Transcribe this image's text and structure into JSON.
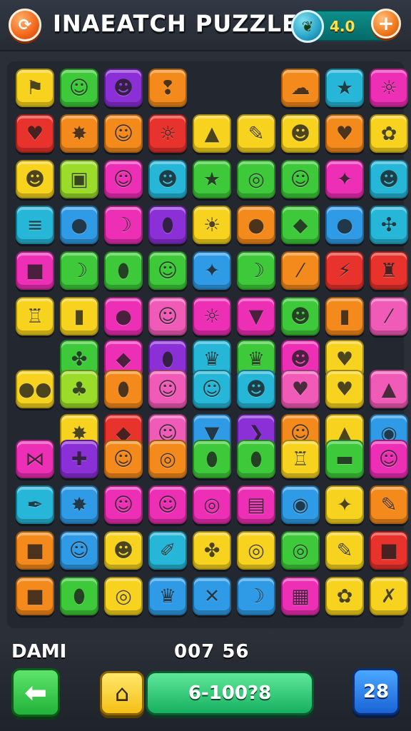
{
  "header": {
    "title": "INAEATCH PUZZLE",
    "settings_icon": "cycle-icon",
    "coin_icon": "leaf-coin-icon",
    "coin_value": "4.0",
    "plus_label": "+"
  },
  "colors": {
    "yellow": "#f7d21e",
    "green": "#3ec93a",
    "blue": "#2f9be6",
    "purple": "#8b2fd6",
    "magenta": "#ec2fb4",
    "orange": "#f48a1c",
    "red": "#e8322c",
    "lime": "#9bdc2a",
    "pink": "#f05bb8",
    "teal": "#25b6d8"
  },
  "board": {
    "tiles": [
      {
        "color": "yellow",
        "icon": "flag-icon",
        "glyph": "⚑"
      },
      {
        "color": "green",
        "icon": "smiley-icon",
        "glyph": "☺"
      },
      {
        "color": "purple",
        "icon": "cat-face-icon",
        "glyph": "☻"
      },
      {
        "color": "orange",
        "icon": "ear-icon",
        "glyph": "❢"
      },
      {
        "color": "orange",
        "icon": "ghost-icon",
        "glyph": "☁"
      },
      {
        "color": "teal",
        "icon": "star-icon",
        "glyph": "★"
      },
      {
        "color": "magenta",
        "icon": "sun-face-icon",
        "glyph": "☼"
      },
      {
        "color": "red",
        "icon": "heart-icon",
        "glyph": "♥"
      },
      {
        "color": "orange",
        "icon": "splat-icon",
        "glyph": "✸"
      },
      {
        "color": "orange",
        "icon": "cat-face-icon",
        "glyph": "☺"
      },
      {
        "color": "red",
        "icon": "sun-face-icon",
        "glyph": "☼"
      },
      {
        "color": "yellow",
        "icon": "triangle-icon",
        "glyph": "▲"
      },
      {
        "color": "yellow",
        "icon": "pencil-icon",
        "glyph": "✎"
      },
      {
        "color": "yellow",
        "icon": "frog-face-icon",
        "glyph": "☻"
      },
      {
        "color": "orange",
        "icon": "heart-icon",
        "glyph": "♥"
      },
      {
        "color": "yellow",
        "icon": "blob-icon",
        "glyph": "✿"
      },
      {
        "color": "yellow",
        "icon": "monster-icon",
        "glyph": "☻"
      },
      {
        "color": "lime",
        "icon": "square-icon",
        "glyph": "▣"
      },
      {
        "color": "magenta",
        "icon": "face-icon",
        "glyph": "☺"
      },
      {
        "color": "teal",
        "icon": "cat-face-icon",
        "glyph": "☻"
      },
      {
        "color": "green",
        "icon": "star-icon",
        "glyph": "★"
      },
      {
        "color": "green",
        "icon": "target-icon",
        "glyph": "◎"
      },
      {
        "color": "green",
        "icon": "face-icon",
        "glyph": "☺"
      },
      {
        "color": "magenta",
        "icon": "star-icon",
        "glyph": "✦"
      },
      {
        "color": "teal",
        "icon": "cat-face-icon",
        "glyph": "☻"
      },
      {
        "color": "teal",
        "icon": "stack-icon",
        "glyph": "≡"
      },
      {
        "color": "blue",
        "icon": "apple-icon",
        "glyph": "●"
      },
      {
        "color": "magenta",
        "icon": "banana-icon",
        "glyph": "☽"
      },
      {
        "color": "purple",
        "icon": "lemon-icon",
        "glyph": "⬮"
      },
      {
        "color": "yellow",
        "icon": "sun-icon",
        "glyph": "☀"
      },
      {
        "color": "orange",
        "icon": "orange-fruit-icon",
        "glyph": "●"
      },
      {
        "color": "green",
        "icon": "gem-icon",
        "glyph": "◆"
      },
      {
        "color": "blue",
        "icon": "berry-icon",
        "glyph": "●"
      },
      {
        "color": "teal",
        "icon": "leaf-icon",
        "glyph": "✣"
      },
      {
        "color": "magenta",
        "icon": "square-icon",
        "glyph": "■"
      },
      {
        "color": "green",
        "icon": "banana-icon",
        "glyph": "☽"
      },
      {
        "color": "green",
        "icon": "seed-icon",
        "glyph": "⬮"
      },
      {
        "color": "green",
        "icon": "face-icon",
        "glyph": "☺"
      },
      {
        "color": "blue",
        "icon": "leaf-icon",
        "glyph": "✦"
      },
      {
        "color": "green",
        "icon": "banana-icon",
        "glyph": "☽"
      },
      {
        "color": "orange",
        "icon": "slash-icon",
        "glyph": "⁄"
      },
      {
        "color": "red",
        "icon": "lightning-icon",
        "glyph": "⚡"
      },
      {
        "color": "red",
        "icon": "castle-icon",
        "glyph": "♜"
      },
      {
        "color": "yellow",
        "icon": "bag-icon",
        "glyph": "♖"
      },
      {
        "color": "yellow",
        "icon": "bottle-icon",
        "glyph": "▮"
      },
      {
        "color": "magenta",
        "icon": "apple-icon",
        "glyph": "●"
      },
      {
        "color": "pink",
        "icon": "face-icon",
        "glyph": "☺"
      },
      {
        "color": "magenta",
        "icon": "sun-face-icon",
        "glyph": "☼"
      },
      {
        "color": "magenta",
        "icon": "pizza-icon",
        "glyph": "▼"
      },
      {
        "color": "green",
        "icon": "frog-face-icon",
        "glyph": "☻"
      },
      {
        "color": "orange",
        "icon": "bottle-icon",
        "glyph": "▮"
      },
      {
        "color": "pink",
        "icon": "slash-icon",
        "glyph": "⁄"
      },
      {
        "color": "green",
        "icon": "paw-icon",
        "glyph": "✤"
      },
      {
        "color": "magenta",
        "icon": "gem-icon",
        "glyph": "◆"
      },
      {
        "color": "purple",
        "icon": "lemon-icon",
        "glyph": "⬮"
      },
      {
        "color": "teal",
        "icon": "crown-icon",
        "glyph": "♛"
      },
      {
        "color": "green",
        "icon": "crown-icon",
        "glyph": "♛"
      },
      {
        "color": "magenta",
        "icon": "cat-face-icon",
        "glyph": "☻"
      },
      {
        "color": "yellow",
        "icon": "heart-icon",
        "glyph": "♥"
      },
      {
        "color": "yellow",
        "icon": "dots-icon",
        "glyph": "●●"
      },
      {
        "color": "lime",
        "icon": "cherry-icon",
        "glyph": "♣"
      },
      {
        "color": "orange",
        "icon": "bean-icon",
        "glyph": "⬮"
      },
      {
        "color": "pink",
        "icon": "face-icon",
        "glyph": "☺"
      },
      {
        "color": "teal",
        "icon": "face-icon",
        "glyph": "☺"
      },
      {
        "color": "teal",
        "icon": "cat-face-icon",
        "glyph": "☻"
      },
      {
        "color": "pink",
        "icon": "heart-icon",
        "glyph": "♥"
      },
      {
        "color": "yellow",
        "icon": "heart-icon",
        "glyph": "♥"
      },
      {
        "color": "pink",
        "icon": "triangle-icon",
        "glyph": "▲"
      },
      {
        "color": "yellow",
        "icon": "splat-icon",
        "glyph": "✸"
      },
      {
        "color": "red",
        "icon": "gem-icon",
        "glyph": "◆"
      },
      {
        "color": "pink",
        "icon": "face-icon",
        "glyph": "☺"
      },
      {
        "color": "blue",
        "icon": "pizza-icon",
        "glyph": "▼"
      },
      {
        "color": "purple",
        "icon": "arrow-icon",
        "glyph": "❯"
      },
      {
        "color": "orange",
        "icon": "face-icon",
        "glyph": "☺"
      },
      {
        "color": "yellow",
        "icon": "triangle-icon",
        "glyph": "▲"
      },
      {
        "color": "blue",
        "icon": "coin-icon",
        "glyph": "◉"
      },
      {
        "color": "magenta",
        "icon": "ribbon-icon",
        "glyph": "⋈"
      },
      {
        "color": "purple",
        "icon": "maze-icon",
        "glyph": "✚"
      },
      {
        "color": "orange",
        "icon": "face-icon",
        "glyph": "☺"
      },
      {
        "color": "orange",
        "icon": "ring-icon",
        "glyph": "◎"
      },
      {
        "color": "green",
        "icon": "seed-icon",
        "glyph": "⬮"
      },
      {
        "color": "green",
        "icon": "leaf-icon",
        "glyph": "⬮"
      },
      {
        "color": "yellow",
        "icon": "bag-icon",
        "glyph": "♖"
      },
      {
        "color": "green",
        "icon": "box-icon",
        "glyph": "▬"
      },
      {
        "color": "magenta",
        "icon": "face-icon",
        "glyph": "☺"
      },
      {
        "color": "teal",
        "icon": "quill-icon",
        "glyph": "✒"
      },
      {
        "color": "blue",
        "icon": "splat-icon",
        "glyph": "✸"
      },
      {
        "color": "magenta",
        "icon": "face-icon",
        "glyph": "☺"
      },
      {
        "color": "magenta",
        "icon": "face-icon",
        "glyph": "☺"
      },
      {
        "color": "magenta",
        "icon": "spiral-icon",
        "glyph": "◎"
      },
      {
        "color": "magenta",
        "icon": "scroll-icon",
        "glyph": "▤"
      },
      {
        "color": "blue",
        "icon": "ring-icon",
        "glyph": "◉"
      },
      {
        "color": "yellow",
        "icon": "star-icon",
        "glyph": "✦"
      },
      {
        "color": "orange",
        "icon": "ruler-icon",
        "glyph": "✎"
      },
      {
        "color": "orange",
        "icon": "square-icon",
        "glyph": "■"
      },
      {
        "color": "blue",
        "icon": "face-icon",
        "glyph": "☺"
      },
      {
        "color": "yellow",
        "icon": "monster-icon",
        "glyph": "☻"
      },
      {
        "color": "teal",
        "icon": "fan-icon",
        "glyph": "✐"
      },
      {
        "color": "yellow",
        "icon": "bird-icon",
        "glyph": "✤"
      },
      {
        "color": "yellow",
        "icon": "target-icon",
        "glyph": "◎"
      },
      {
        "color": "green",
        "icon": "spiral-icon",
        "glyph": "◎"
      },
      {
        "color": "yellow",
        "icon": "pencil-icon",
        "glyph": "✎"
      },
      {
        "color": "red",
        "icon": "square-icon",
        "glyph": "■"
      },
      {
        "color": "orange",
        "icon": "square-icon",
        "glyph": "■"
      },
      {
        "color": "green",
        "icon": "leaf-icon",
        "glyph": "⬮"
      },
      {
        "color": "yellow",
        "icon": "spiral-icon",
        "glyph": "◎"
      },
      {
        "color": "blue",
        "icon": "crown-icon",
        "glyph": "♛"
      },
      {
        "color": "blue",
        "icon": "sticks-icon",
        "glyph": "✕"
      },
      {
        "color": "blue",
        "icon": "banana-icon",
        "glyph": "☽"
      },
      {
        "color": "magenta",
        "icon": "grid-icon",
        "glyph": "▦"
      },
      {
        "color": "yellow",
        "icon": "tulip-icon",
        "glyph": "✿"
      },
      {
        "color": "yellow",
        "icon": "cross-icon",
        "glyph": "✗"
      }
    ]
  },
  "footer": {
    "player_label": "DAMI",
    "score_label": "007 56",
    "back_icon": "back-arrow-icon",
    "home_icon": "home-icon",
    "moves_text": "6-100?8",
    "level_value": "28"
  }
}
